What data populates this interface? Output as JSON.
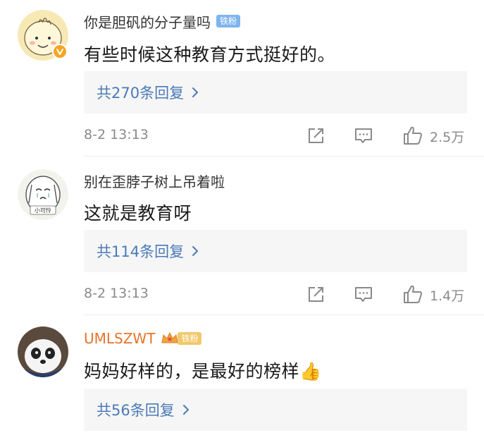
{
  "comments": [
    {
      "username": "你是胆矾的分子量吗",
      "badge": "铁粉",
      "text": "有些时候这种教育方式挺好的。",
      "replies": "共270条回复",
      "time": "8-2 13:13",
      "likes": "2.5万",
      "verified": true
    },
    {
      "username": "别在歪脖子树上吊着啦",
      "text": "这就是教育呀",
      "replies": "共114条回复",
      "time": "8-2 13:13",
      "likes": "1.4万",
      "avatar_caption": "小可怜"
    },
    {
      "username": "UMLSZWT",
      "badge": "铁粉",
      "text": "妈妈好样的，是最好的榜样👍",
      "replies": "共56条回复"
    }
  ],
  "icons": {
    "share": "share-icon",
    "comment": "comment-icon",
    "like": "thumbs-up-icon",
    "chevron": "chevron-right-icon",
    "verified": "verified-v-icon",
    "crown": "crown-icon"
  },
  "colors": {
    "link": "#4a7ab7",
    "vip_name": "#e8742a",
    "fan_badge": "#7fb4ee",
    "fan_badge_gold": "#f3c76a",
    "meta": "#8a8a8a",
    "verified": "#f5a623"
  }
}
